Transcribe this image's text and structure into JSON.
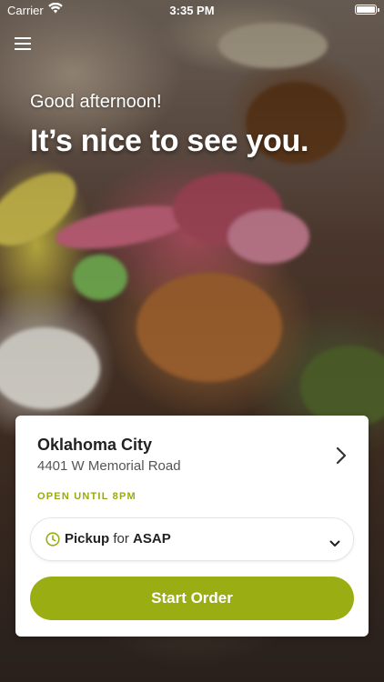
{
  "status_bar": {
    "carrier": "Carrier",
    "time": "3:35 PM"
  },
  "hero": {
    "greeting": "Good afternoon!",
    "headline": "It’s nice to see you."
  },
  "location": {
    "name": "Oklahoma City",
    "address": "4401 W Memorial Road",
    "hours": "OPEN UNTIL 8PM"
  },
  "order_type": {
    "mode": "Pickup",
    "connector": "for",
    "time": "ASAP"
  },
  "actions": {
    "start_label": "Start Order"
  },
  "colors": {
    "accent": "#9aad12",
    "hours_text": "#9aaa10"
  },
  "icons": {
    "menu": "hamburger-menu-icon",
    "location_chevron": "chevron-right-icon",
    "clock": "clock-icon",
    "dropdown": "chevron-down-icon",
    "wifi": "wifi-icon",
    "battery": "battery-icon"
  }
}
